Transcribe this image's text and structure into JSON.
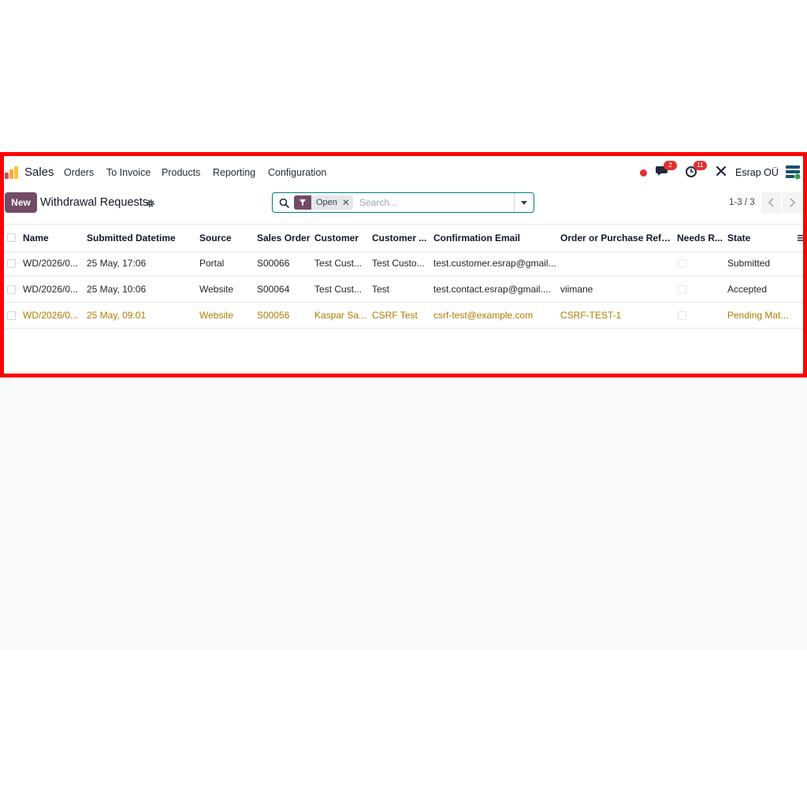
{
  "navbar": {
    "app_name": "Sales",
    "menu": [
      "Orders",
      "To Invoice",
      "Products",
      "Reporting",
      "Configuration"
    ],
    "messages_badge": "2",
    "activities_badge": "11",
    "company": "Esrap OÜ"
  },
  "control_panel": {
    "new_label": "New",
    "title": "Withdrawal Requests",
    "search": {
      "facet": "Open",
      "placeholder": "Search..."
    },
    "pager": "1-3 / 3"
  },
  "table": {
    "columns": [
      "Name",
      "Submitted Datetime",
      "Source",
      "Sales Order",
      "Customer",
      "Customer ...",
      "Confirmation Email",
      "Order or Purchase Refer...",
      "Needs R...",
      "State"
    ],
    "rows": [
      {
        "name": "WD/2026/0...",
        "datetime": "25 May, 17:06",
        "source": "Portal",
        "sales_order": "S00066",
        "customer": "Test Cust...",
        "customer2": "Test Custo...",
        "email": "test.customer.esrap@gmail...",
        "reference": "",
        "state": "Submitted",
        "highlight": false
      },
      {
        "name": "WD/2026/0...",
        "datetime": "25 May, 10:06",
        "source": "Website",
        "sales_order": "S00064",
        "customer": "Test Cust...",
        "customer2": "Test",
        "email": "test.contact.esrap@gmail....",
        "reference": "viimane",
        "state": "Accepted",
        "highlight": false
      },
      {
        "name": "WD/2026/0...",
        "datetime": "25 May, 09:01",
        "source": "Website",
        "sales_order": "S00056",
        "customer": "Kaspar Sa...",
        "customer2": "CSRF Test",
        "email": "csrf-test@example.com",
        "reference": "CSRF-TEST-1",
        "state": "Pending Mat...",
        "highlight": true
      }
    ]
  },
  "colors": {
    "brand": "#714b67",
    "warning_row": "#b07b00",
    "frame": "#ff0000"
  }
}
